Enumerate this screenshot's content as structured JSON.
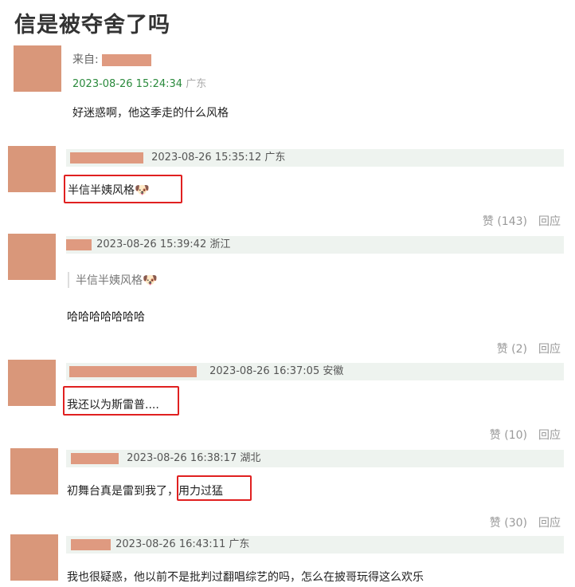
{
  "page": {
    "title": "信是被夺舍了吗"
  },
  "post": {
    "from_label": "来自: ",
    "timestamp": "2023-08-26 15:24:34",
    "region": "广东",
    "content": "好迷惑啊，他这季走的什么风格"
  },
  "comments": [
    {
      "timestamp": "2023-08-26 15:35:12",
      "region": "广东",
      "content": "半信半姨风格",
      "emoji": "🐶",
      "likes": "赞 (143)",
      "reply": "回应"
    },
    {
      "timestamp": "2023-08-26 15:39:42",
      "region": "浙江",
      "quote": "半信半姨风格",
      "emoji": "🐶",
      "content": "哈哈哈哈哈哈哈",
      "likes": "赞 (2)",
      "reply": "回应"
    },
    {
      "timestamp": "2023-08-26 16:37:05",
      "region": "安徽",
      "content": "我还以为斯雷普....",
      "likes": "赞 (10)",
      "reply": "回应"
    },
    {
      "timestamp": "2023-08-26 16:38:17",
      "region": "湖北",
      "content_a": "初舞台真是雷到我了，",
      "content_b": "用力过猛",
      "likes": "赞 (30)",
      "reply": "回应"
    },
    {
      "timestamp": "2023-08-26 16:43:11",
      "region": "广东",
      "content": "我也很疑惑，他以前不是批判过翻唱综艺的吗，怎么在披哥玩得这么欢乐"
    }
  ]
}
